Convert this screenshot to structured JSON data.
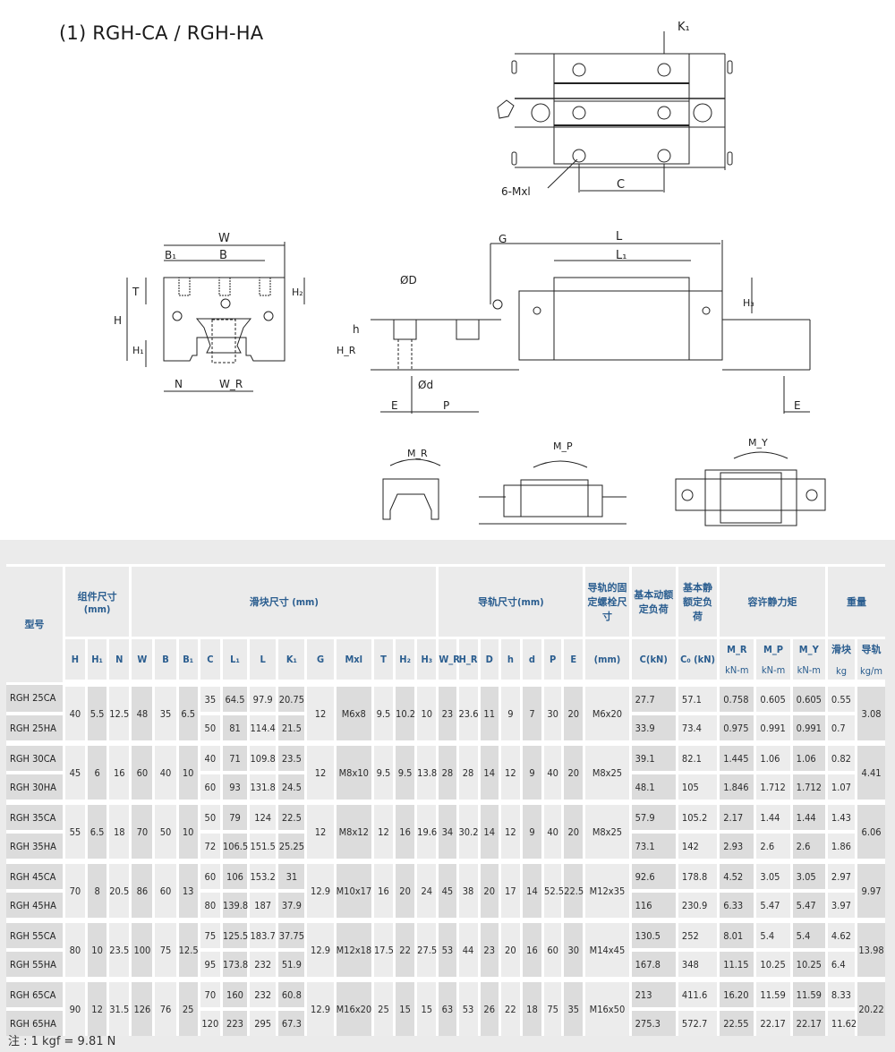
{
  "title": "(1) RGH-CA / RGH-HA",
  "drawing_labels": {
    "top_view": {
      "k1": "K₁",
      "c": "C",
      "mxl": "6-Mxl"
    },
    "front_view": {
      "w": "W",
      "b1": "B₁",
      "b": "B",
      "t": "T",
      "h": "H",
      "h1": "H₁",
      "h2": "H₂",
      "n": "N",
      "wr": "W_R"
    },
    "side_view": {
      "g": "G",
      "l": "L",
      "l1": "L₁",
      "h3": "H₃",
      "od": "ØD",
      "h": "h",
      "hr": "H_R",
      "d": "Ød",
      "e_left": "E",
      "p": "P",
      "e_right": "E"
    },
    "moments": {
      "mr": "M_R",
      "mp": "M_P",
      "my": "M_Y"
    }
  },
  "table": {
    "group_headers": {
      "model": "型号",
      "assembly": "组件尺寸 (mm)",
      "block": "滑块尺寸 (mm)",
      "rail": "导轨尺寸(mm)",
      "bolt": "导轨的固定螺栓尺寸",
      "dynamic": "基本动额定负荷",
      "static": "基本静额定负荷",
      "moment": "容许静力矩",
      "weight": "重量"
    },
    "sub_headers": {
      "assembly": [
        "H",
        "H₁",
        "N"
      ],
      "block": [
        "W",
        "B",
        "B₁",
        "C",
        "L₁",
        "L",
        "K₁",
        "G",
        "Mxl",
        "T",
        "H₂",
        "H₃"
      ],
      "rail": [
        "W_R",
        "H_R",
        "D",
        "h",
        "d",
        "P",
        "E"
      ],
      "bolt": "(mm)",
      "dynamic": "C(kN)",
      "static": "C₀ (kN)",
      "moment": [
        "M_R",
        "M_P",
        "M_Y"
      ],
      "moment_unit": "kN-m",
      "weight": [
        "滑块",
        "导轨"
      ],
      "weight_unit": [
        "kg",
        "kg/m"
      ]
    },
    "groups": [
      {
        "shared": {
          "H": "40",
          "H1": "5.5",
          "N": "12.5",
          "W": "48",
          "B": "35",
          "B1": "6.5",
          "G": "12",
          "Mxl": "M6x8",
          "T": "9.5",
          "H2": "10.2",
          "H3": "10",
          "WR": "23",
          "HR": "23.6",
          "D": "11",
          "h": "9",
          "d": "7",
          "P": "30",
          "E": "20",
          "bolt": "M6x20",
          "rail_kgm": "3.08"
        },
        "rows": [
          {
            "model": "RGH 25CA",
            "C": "35",
            "L1": "64.5",
            "L": "97.9",
            "K1": "20.75",
            "Cdyn": "27.7",
            "C0": "57.1",
            "MR": "0.758",
            "MP": "0.605",
            "MY": "0.605",
            "block_kg": "0.55"
          },
          {
            "model": "RGH 25HA",
            "C": "50",
            "L1": "81",
            "L": "114.4",
            "K1": "21.5",
            "Cdyn": "33.9",
            "C0": "73.4",
            "MR": "0.975",
            "MP": "0.991",
            "MY": "0.991",
            "block_kg": "0.7"
          }
        ]
      },
      {
        "shared": {
          "H": "45",
          "H1": "6",
          "N": "16",
          "W": "60",
          "B": "40",
          "B1": "10",
          "G": "12",
          "Mxl": "M8x10",
          "T": "9.5",
          "H2": "9.5",
          "H3": "13.8",
          "WR": "28",
          "HR": "28",
          "D": "14",
          "h": "12",
          "d": "9",
          "P": "40",
          "E": "20",
          "bolt": "M8x25",
          "rail_kgm": "4.41"
        },
        "rows": [
          {
            "model": "RGH 30CA",
            "C": "40",
            "L1": "71",
            "L": "109.8",
            "K1": "23.5",
            "Cdyn": "39.1",
            "C0": "82.1",
            "MR": "1.445",
            "MP": "1.06",
            "MY": "1.06",
            "block_kg": "0.82"
          },
          {
            "model": "RGH 30HA",
            "C": "60",
            "L1": "93",
            "L": "131.8",
            "K1": "24.5",
            "Cdyn": "48.1",
            "C0": "105",
            "MR": "1.846",
            "MP": "1.712",
            "MY": "1.712",
            "block_kg": "1.07"
          }
        ]
      },
      {
        "shared": {
          "H": "55",
          "H1": "6.5",
          "N": "18",
          "W": "70",
          "B": "50",
          "B1": "10",
          "G": "12",
          "Mxl": "M8x12",
          "T": "12",
          "H2": "16",
          "H3": "19.6",
          "WR": "34",
          "HR": "30.2",
          "D": "14",
          "h": "12",
          "d": "9",
          "P": "40",
          "E": "20",
          "bolt": "M8x25",
          "rail_kgm": "6.06"
        },
        "rows": [
          {
            "model": "RGH 35CA",
            "C": "50",
            "L1": "79",
            "L": "124",
            "K1": "22.5",
            "Cdyn": "57.9",
            "C0": "105.2",
            "MR": "2.17",
            "MP": "1.44",
            "MY": "1.44",
            "block_kg": "1.43"
          },
          {
            "model": "RGH 35HA",
            "C": "72",
            "L1": "106.5",
            "L": "151.5",
            "K1": "25.25",
            "Cdyn": "73.1",
            "C0": "142",
            "MR": "2.93",
            "MP": "2.6",
            "MY": "2.6",
            "block_kg": "1.86"
          }
        ]
      },
      {
        "shared": {
          "H": "70",
          "H1": "8",
          "N": "20.5",
          "W": "86",
          "B": "60",
          "B1": "13",
          "G": "12.9",
          "Mxl": "M10x17",
          "T": "16",
          "H2": "20",
          "H3": "24",
          "WR": "45",
          "HR": "38",
          "D": "20",
          "h": "17",
          "d": "14",
          "P": "52.5",
          "E": "22.5",
          "bolt": "M12x35",
          "rail_kgm": "9.97"
        },
        "rows": [
          {
            "model": "RGH 45CA",
            "C": "60",
            "L1": "106",
            "L": "153.2",
            "K1": "31",
            "Cdyn": "92.6",
            "C0": "178.8",
            "MR": "4.52",
            "MP": "3.05",
            "MY": "3.05",
            "block_kg": "2.97"
          },
          {
            "model": "RGH 45HA",
            "C": "80",
            "L1": "139.8",
            "L": "187",
            "K1": "37.9",
            "Cdyn": "116",
            "C0": "230.9",
            "MR": "6.33",
            "MP": "5.47",
            "MY": "5.47",
            "block_kg": "3.97"
          }
        ]
      },
      {
        "shared": {
          "H": "80",
          "H1": "10",
          "N": "23.5",
          "W": "100",
          "B": "75",
          "B1": "12.5",
          "G": "12.9",
          "Mxl": "M12x18",
          "T": "17.5",
          "H2": "22",
          "H3": "27.5",
          "WR": "53",
          "HR": "44",
          "D": "23",
          "h": "20",
          "d": "16",
          "P": "60",
          "E": "30",
          "bolt": "M14x45",
          "rail_kgm": "13.98"
        },
        "rows": [
          {
            "model": "RGH 55CA",
            "C": "75",
            "L1": "125.5",
            "L": "183.7",
            "K1": "37.75",
            "Cdyn": "130.5",
            "C0": "252",
            "MR": "8.01",
            "MP": "5.4",
            "MY": "5.4",
            "block_kg": "4.62"
          },
          {
            "model": "RGH 55HA",
            "C": "95",
            "L1": "173.8",
            "L": "232",
            "K1": "51.9",
            "Cdyn": "167.8",
            "C0": "348",
            "MR": "11.15",
            "MP": "10.25",
            "MY": "10.25",
            "block_kg": "6.4"
          }
        ]
      },
      {
        "shared": {
          "H": "90",
          "H1": "12",
          "N": "31.5",
          "W": "126",
          "B": "76",
          "B1": "25",
          "G": "12.9",
          "Mxl": "M16x20",
          "T": "25",
          "H2": "15",
          "H3": "15",
          "WR": "63",
          "HR": "53",
          "D": "26",
          "h": "22",
          "d": "18",
          "P": "75",
          "E": "35",
          "bolt": "M16x50",
          "rail_kgm": "20.22"
        },
        "rows": [
          {
            "model": "RGH 65CA",
            "C": "70",
            "L1": "160",
            "L": "232",
            "K1": "60.8",
            "Cdyn": "213",
            "C0": "411.6",
            "MR": "16.20",
            "MP": "11.59",
            "MY": "11.59",
            "block_kg": "8.33"
          },
          {
            "model": "RGH 65HA",
            "C": "120",
            "L1": "223",
            "L": "295",
            "K1": "67.3",
            "Cdyn": "275.3",
            "C0": "572.7",
            "MR": "22.55",
            "MP": "22.17",
            "MY": "22.17",
            "block_kg": "11.62"
          }
        ]
      }
    ]
  },
  "note": "注 : 1 kgf = 9.81 N",
  "colors": {
    "header_text": "#2a5d8f",
    "panel_bg": "#ebebeb",
    "dark_col": "#dcdcdc",
    "light_col": "#ececec"
  }
}
